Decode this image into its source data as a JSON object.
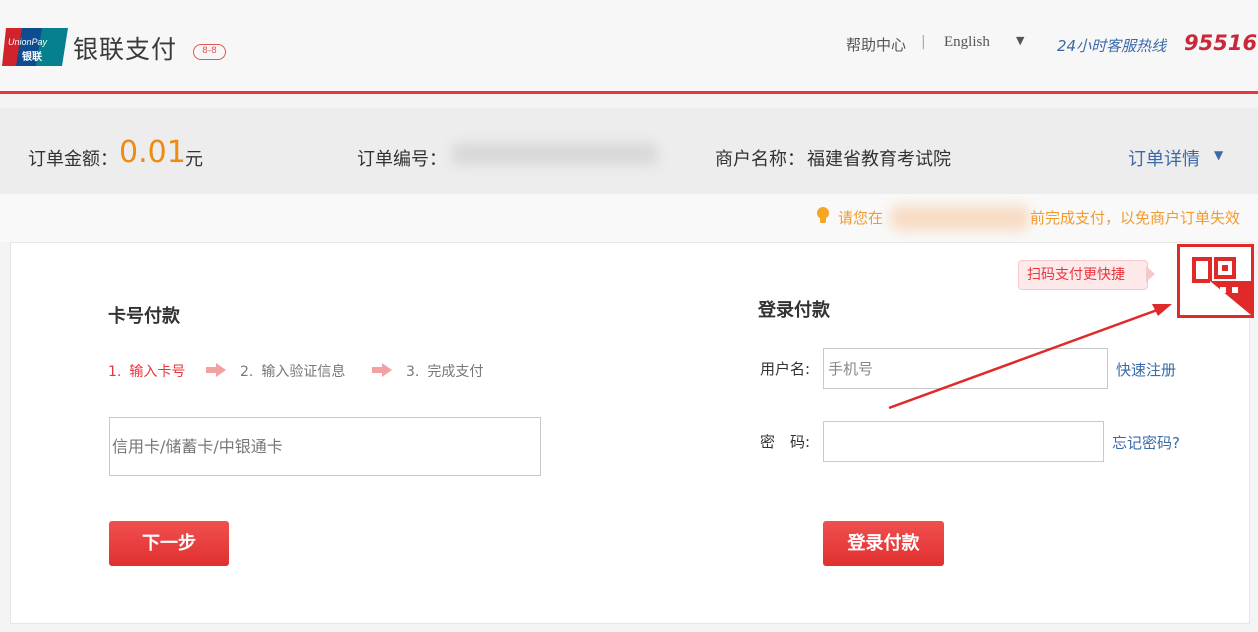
{
  "header": {
    "brand_name": "银联支付",
    "brand_badge": "8-8",
    "help_link": "帮助中心",
    "separator": "|",
    "language": "English",
    "language_caret": "▼",
    "hotline_label": "24小时客服热线",
    "hotline_number": "95516",
    "logo_text_top": "UnionPay",
    "logo_text_bottom": "银联"
  },
  "order": {
    "amount_label": "订单金额：",
    "amount_value": "0.01",
    "amount_unit": "元",
    "number_label": "订单编号：",
    "merchant_label": "商户名称：",
    "merchant_name": "福建省教育考试院",
    "detail_link": "订单详情",
    "detail_caret": "▼"
  },
  "notice": {
    "text_start": "请您在",
    "text_end": "前完成支付，以免商户订单失效"
  },
  "card_pay": {
    "title": "卡号付款",
    "steps": [
      {
        "num": "1.",
        "label": "输入卡号"
      },
      {
        "num": "2.",
        "label": "输入验证信息"
      },
      {
        "num": "3.",
        "label": "完成支付"
      }
    ],
    "card_placeholder": "信用卡/储蓄卡/中银通卡",
    "next_button": "下一步"
  },
  "login_pay": {
    "title": "登录付款",
    "username_label": "用户名:",
    "username_placeholder": "手机号",
    "register_link": "快速注册",
    "password_label": "密　码:",
    "forgot_link": "忘记密码?",
    "login_button": "登录付款"
  },
  "qr": {
    "tip": "扫码支付更快捷",
    "icon": "qr-code-icon"
  },
  "colors": {
    "accent_red": "#e8343b",
    "amount_orange": "#f08a14",
    "link_blue": "#3a6aa8",
    "notice_orange": "#f29b2e"
  }
}
